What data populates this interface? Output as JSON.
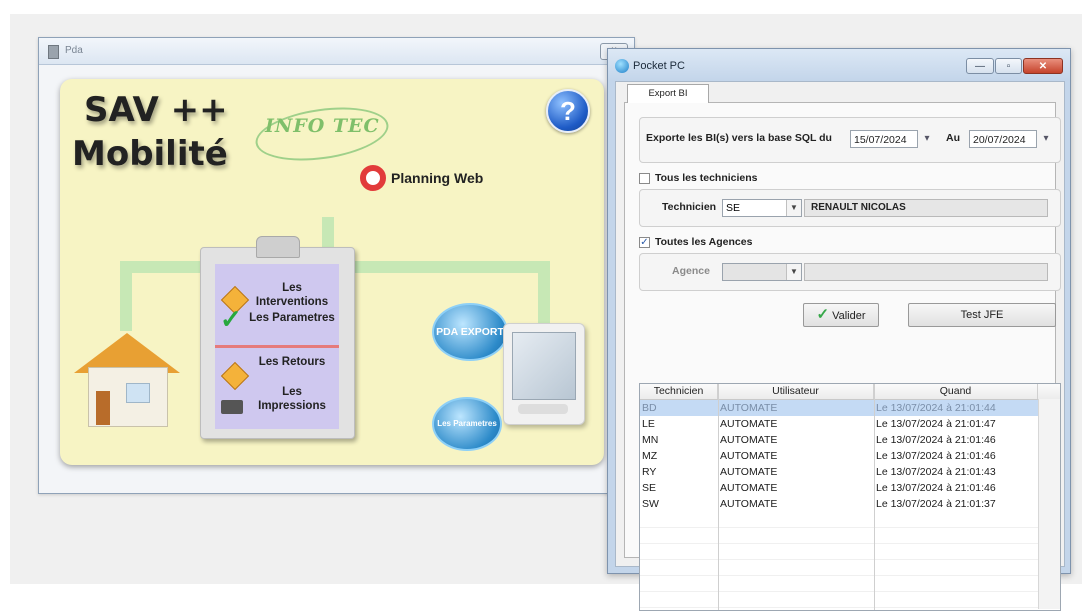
{
  "pda_window": {
    "title": "Pda",
    "close_label": "×",
    "panel": {
      "title_line1": "SAV ++",
      "title_line2": "Mobilité",
      "help_label": "?",
      "brand": "INFO TEC",
      "planning_label": "Planning Web",
      "menu": {
        "interventions": "Les Interventions",
        "parametres": "Les Parametres",
        "retours": "Les Retours",
        "impressions": "Les Impressions"
      },
      "pda_export_label": "PDA EXPORT",
      "params_bubble_label": "Les Parametres"
    }
  },
  "pocket_window": {
    "title": "Pocket PC",
    "controls": {
      "minimize": "—",
      "maximize": "▫",
      "close": "✕"
    },
    "tab_label": "Export BI",
    "export_label": "Exporte les BI(s) vers la base SQL du",
    "date_from": "15/07/2024",
    "au_label": "Au",
    "date_to": "20/07/2024",
    "all_techs_label": "Tous les techniciens",
    "all_techs_checked": false,
    "technicien_label": "Technicien",
    "technicien_code": "SE",
    "technicien_name": "RENAULT NICOLAS",
    "all_agencies_label": "Toutes les Agences",
    "all_agencies_checked": true,
    "agence_label": "Agence",
    "validate_label": "Valider",
    "test_label": "Test JFE",
    "grid": {
      "headers": [
        "Technicien",
        "Utilisateur",
        "Quand"
      ],
      "rows": [
        {
          "tech": "BD",
          "user": "AUTOMATE",
          "when": "Le 13/07/2024 à 21:01:44",
          "selected": true
        },
        {
          "tech": "LE",
          "user": "AUTOMATE",
          "when": "Le 13/07/2024 à 21:01:47",
          "selected": false
        },
        {
          "tech": "MN",
          "user": "AUTOMATE",
          "when": "Le 13/07/2024 à 21:01:46",
          "selected": false
        },
        {
          "tech": "MZ",
          "user": "AUTOMATE",
          "when": "Le 13/07/2024 à 21:01:46",
          "selected": false
        },
        {
          "tech": "RY",
          "user": "AUTOMATE",
          "when": "Le 13/07/2024 à 21:01:43",
          "selected": false
        },
        {
          "tech": "SE",
          "user": "AUTOMATE",
          "when": "Le 13/07/2024 à 21:01:46",
          "selected": false
        },
        {
          "tech": "SW",
          "user": "AUTOMATE",
          "when": "Le 13/07/2024 à 21:01:37",
          "selected": false
        }
      ]
    }
  },
  "colors": {
    "panel_bg": "#f7f4c4",
    "selection": "#c4daf4",
    "close_button": "#c5432b"
  }
}
